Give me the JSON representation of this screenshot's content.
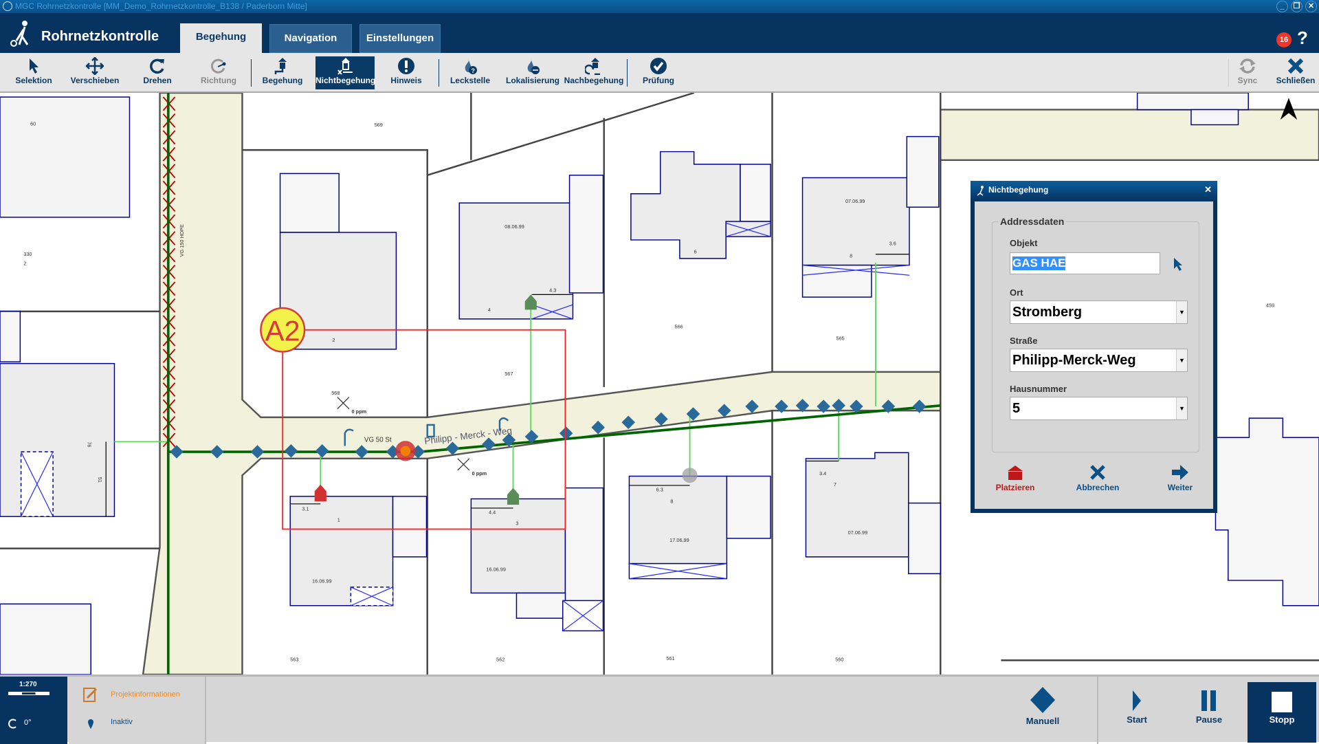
{
  "window": {
    "title": "MGC Rohrnetzkontrolle [MM_Demo_Rohrnetzkontrolle_B138 / Paderborn Mitte]",
    "minimize": "_",
    "restore": "❐",
    "close": "✕"
  },
  "header": {
    "app_name": "Rohrnetzkontrolle",
    "tabs": [
      {
        "label": "Begehung",
        "active": true
      },
      {
        "label": "Navigation"
      },
      {
        "label": "Einstellungen"
      }
    ],
    "notification_count": "16",
    "help": "?"
  },
  "toolbar": {
    "items": [
      {
        "label": "Selektion",
        "icon": "cursor-icon"
      },
      {
        "label": "Verschieben",
        "icon": "move-icon"
      },
      {
        "label": "Drehen",
        "icon": "rotate-icon"
      },
      {
        "label": "Richtung",
        "icon": "direction-icon",
        "disabled": true
      },
      {
        "label": "Begehung",
        "icon": "house-pipe-icon"
      },
      {
        "label": "Nichtbegehung",
        "icon": "house-x-icon",
        "active": true
      },
      {
        "label": "Hinweis",
        "icon": "exclamation-icon"
      },
      {
        "label": "Leckstelle",
        "icon": "flame-question-icon"
      },
      {
        "label": "Lokalisierung",
        "icon": "flame-locate-icon"
      },
      {
        "label": "Nachbegehung",
        "icon": "house-refresh-icon"
      },
      {
        "label": "Prüfung",
        "icon": "check-icon"
      }
    ],
    "sync": "Sync",
    "close": "Schließen"
  },
  "map": {
    "labels": [
      "569",
      "60",
      "330",
      "2",
      "VG 150 HDPE",
      "568",
      "0 ppm",
      "567",
      "566",
      "565",
      "08.06.99",
      "07.06.99",
      "4",
      "6",
      "8",
      "2",
      "1",
      "3",
      "8",
      "7",
      "16.06.99",
      "16.06.99",
      "17.06.99",
      "07.06.99",
      "563",
      "562",
      "561",
      "560",
      "459",
      "VG 50 St",
      "Philipp - Merck - Weg",
      "0 ppm",
      "4.3",
      "3.6",
      "3.1",
      "4.4",
      "6.3",
      "3.4",
      "A2",
      "76",
      "51"
    ],
    "colors": {
      "pipe": "#006400",
      "road": "#f2f2dc",
      "building": "#ececec",
      "building_outline": "#00008b",
      "selection": "#ff2020",
      "marker": "#2a6a9a"
    }
  },
  "dialog": {
    "title": "Nichtbegehung",
    "group": "Addressdaten",
    "objekt_label": "Objekt",
    "objekt_value": "GAS HAE",
    "ort_label": "Ort",
    "ort_value": "Stromberg",
    "strasse_label": "Straße",
    "strasse_value": "Philipp-Merck-Weg",
    "hausnummer_label": "Hausnummer",
    "hausnummer_value": "5",
    "buttons": {
      "place": "Platzieren",
      "cancel": "Abbrechen",
      "next": "Weiter"
    }
  },
  "bottom": {
    "scale": "1:270",
    "rotation": "0°",
    "project_info": "Projektinformationen",
    "gps_status": "Inaktiv",
    "manual": "Manuell",
    "start": "Start",
    "pause": "Pause",
    "stop": "Stopp"
  }
}
